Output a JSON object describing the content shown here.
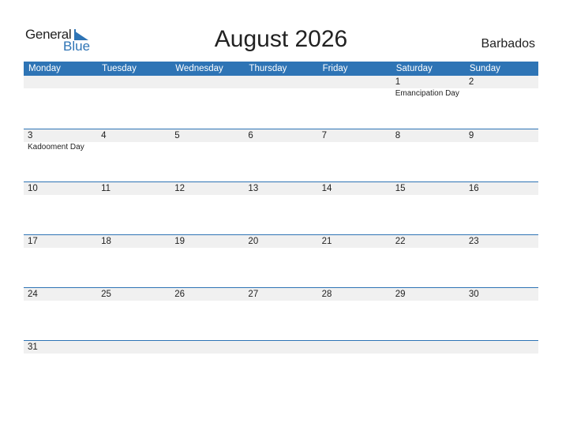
{
  "logo": {
    "text_general": "General",
    "text_blue": "Blue",
    "accent": "#2e74b5"
  },
  "title": "August 2026",
  "country": "Barbados",
  "weekdays": [
    "Monday",
    "Tuesday",
    "Wednesday",
    "Thursday",
    "Friday",
    "Saturday",
    "Sunday"
  ],
  "weeks": [
    [
      {
        "d": ""
      },
      {
        "d": ""
      },
      {
        "d": ""
      },
      {
        "d": ""
      },
      {
        "d": ""
      },
      {
        "d": "1",
        "h": "Emancipation Day"
      },
      {
        "d": "2"
      }
    ],
    [
      {
        "d": "3",
        "h": "Kadooment Day"
      },
      {
        "d": "4"
      },
      {
        "d": "5"
      },
      {
        "d": "6"
      },
      {
        "d": "7"
      },
      {
        "d": "8"
      },
      {
        "d": "9"
      }
    ],
    [
      {
        "d": "10"
      },
      {
        "d": "11"
      },
      {
        "d": "12"
      },
      {
        "d": "13"
      },
      {
        "d": "14"
      },
      {
        "d": "15"
      },
      {
        "d": "16"
      }
    ],
    [
      {
        "d": "17"
      },
      {
        "d": "18"
      },
      {
        "d": "19"
      },
      {
        "d": "20"
      },
      {
        "d": "21"
      },
      {
        "d": "22"
      },
      {
        "d": "23"
      }
    ],
    [
      {
        "d": "24"
      },
      {
        "d": "25"
      },
      {
        "d": "26"
      },
      {
        "d": "27"
      },
      {
        "d": "28"
      },
      {
        "d": "29"
      },
      {
        "d": "30"
      }
    ],
    [
      {
        "d": "31"
      },
      {
        "d": ""
      },
      {
        "d": ""
      },
      {
        "d": ""
      },
      {
        "d": ""
      },
      {
        "d": ""
      },
      {
        "d": ""
      }
    ]
  ]
}
